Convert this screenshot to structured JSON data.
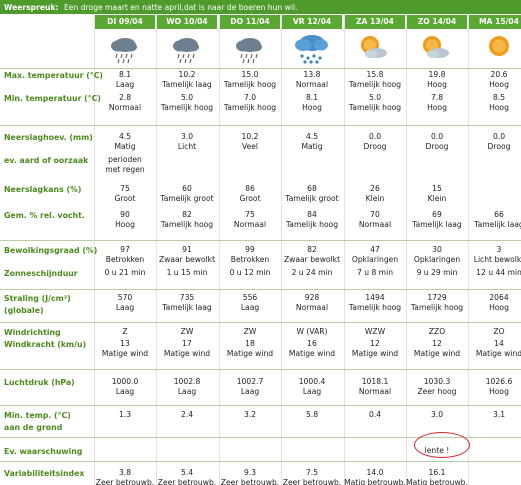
{
  "banner": {
    "label": "Weerspreuk:",
    "text": "Een droge maart en natte april,dat is naar de boeren hun wil."
  },
  "days": [
    {
      "label": "DI 09/04",
      "icon": "cloud-rain-icon"
    },
    {
      "label": "WO 10/04",
      "icon": "cloud-rain-icon"
    },
    {
      "label": "DO 11/04",
      "icon": "cloud-rain-icon"
    },
    {
      "label": "VR 12/04",
      "icon": "heavy-rain-icon"
    },
    {
      "label": "ZA 13/04",
      "icon": "sun-cloud-icon"
    },
    {
      "label": "ZO 14/04",
      "icon": "sun-cloud-icon"
    },
    {
      "label": "MA 15/04",
      "icon": "sun-icon"
    }
  ],
  "rows": {
    "max_temp": {
      "label": "Max. temperatuur (°C)",
      "values": [
        "8.1",
        "10.2",
        "15.0",
        "13.8",
        "15.8",
        "19.8",
        "20.6"
      ],
      "sub": [
        "Laag",
        "Tamelijk laag",
        "Tamelijk hoog",
        "Normaal",
        "Tamelijk hoog",
        "Hoog",
        "Hoog"
      ]
    },
    "min_temp": {
      "label": "Min. temperatuur (°C)",
      "values": [
        "2.8",
        "5.0",
        "7.0",
        "8.1",
        "5.0",
        "7.8",
        "8.5"
      ],
      "sub": [
        "Normaal",
        "Tamelijk hoog",
        "Tamelijk hoog",
        "Hoog",
        "Tamelijk hoog",
        "Hoog",
        "Hoog"
      ]
    },
    "precip": {
      "label": "Neerslaghoev. (mm)",
      "values": [
        "4.5",
        "3.0",
        "10.2",
        "4.5",
        "0.0",
        "0.0",
        "0.0"
      ],
      "sub": [
        "Matig",
        "Licht",
        "Veel",
        "Matig",
        "Droog",
        "Droog",
        "Droog"
      ]
    },
    "precip_type": {
      "label": "ev. aard of oorzaak",
      "values": [
        "perioden",
        "",
        "",
        "",
        "",
        "",
        ""
      ],
      "sub": [
        "met regen",
        "",
        "",
        "",
        "",
        "",
        ""
      ]
    },
    "precip_chance": {
      "label": "Neerslagkans (%)",
      "values": [
        "75",
        "60",
        "86",
        "68",
        "26",
        "15",
        ""
      ],
      "sub": [
        "Groot",
        "Tamelijk groot",
        "Groot",
        "Tamelijk groot",
        "Klein",
        "Klein",
        ""
      ]
    },
    "humidity": {
      "label": "Gem. % rel. vocht.",
      "values": [
        "90",
        "82",
        "75",
        "84",
        "70",
        "69",
        "66"
      ],
      "sub": [
        "Hoog",
        "Tamelijk hoog",
        "Normaal",
        "Tamelijk hoog",
        "Normaal",
        "Tamelijk laag",
        "Tamelijk laag"
      ]
    },
    "cloud": {
      "label": "Bewolkingsgraad (%)",
      "values": [
        "97",
        "91",
        "99",
        "82",
        "47",
        "30",
        "3"
      ],
      "sub": [
        "Betrokken",
        "Zwaar bewolkt",
        "Betrokken",
        "Zwaar bewolkt",
        "Opklaringen",
        "Opklaringen",
        "Licht bewolkt"
      ]
    },
    "sunshine": {
      "label": "Zonneschijnduur",
      "values": [
        "0 u 21 min",
        "1 u 15 min",
        "0 u 12 min",
        "2 u 24 min",
        "7 u 8 min",
        "9 u 29 min",
        "12 u 44 min"
      ]
    },
    "radiation": {
      "label": "Straling (J/cm²)",
      "label2": "(globale)",
      "values": [
        "570",
        "735",
        "556",
        "928",
        "1494",
        "1729",
        "2064"
      ],
      "sub": [
        "Laag",
        "Tamelijk laag",
        "Laag",
        "Normaal",
        "Tamelijk hoog",
        "Tamelijk hoog",
        "Hoog"
      ]
    },
    "wind_dir": {
      "label": "Windrichting",
      "values": [
        "Z",
        "ZW",
        "ZW",
        "W (VAR)",
        "WZW",
        "ZZO",
        "ZO"
      ]
    },
    "wind_speed": {
      "label": "Windkracht (km/u)",
      "values": [
        "13",
        "17",
        "18",
        "16",
        "12",
        "12",
        "14"
      ],
      "sub": [
        "Matige wind",
        "Matige wind",
        "Matige wind",
        "Matige wind",
        "Matige wind",
        "Matige wind",
        "Matige wind"
      ]
    },
    "pressure": {
      "label": "Luchtdruk (hPa)",
      "values": [
        "1000.0",
        "1002.8",
        "1002.7",
        "1000.4",
        "1018.1",
        "1030.3",
        "1026.6"
      ],
      "sub": [
        "Laag",
        "Laag",
        "Laag",
        "Laag",
        "Normaal",
        "Zeer hoog",
        "Hoog"
      ]
    },
    "ground_temp": {
      "label": "Min. temp. (°C)",
      "label2": "aan de grond",
      "values": [
        "1.3",
        "2.4",
        "3.2",
        "5.8",
        "0.4",
        "3.0",
        "3.1"
      ]
    },
    "warning": {
      "label": "Ev. waarschuwing",
      "values": [
        "",
        "",
        "",
        "",
        "",
        "lente !",
        ""
      ]
    },
    "variability": {
      "label": "Variabiliteitsindex",
      "values": [
        "3.8",
        "5.4",
        "9.3",
        "7.5",
        "14.0",
        "16.1",
        ""
      ],
      "sub": [
        "Zeer betrouwb.",
        "Zeer betrouwb.",
        "Zeer betrouwb.",
        "Zeer betrouwb.",
        "Matig betrouwb.",
        "Matig betrouwb.",
        ""
      ]
    }
  }
}
